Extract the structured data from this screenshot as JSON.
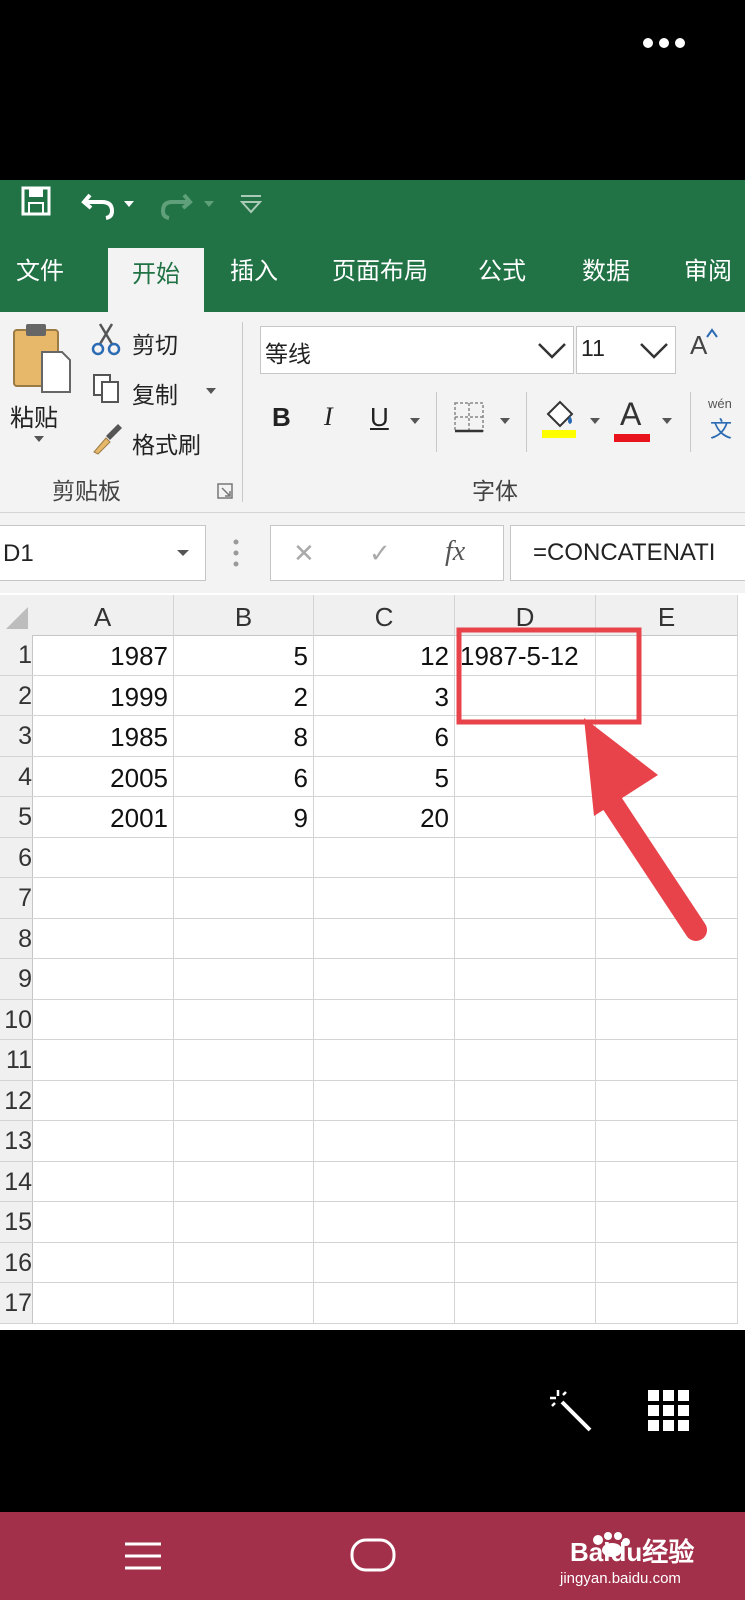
{
  "excel": {
    "tabs": [
      "文件",
      "开始",
      "插入",
      "页面布局",
      "公式",
      "数据",
      "审阅"
    ],
    "active_tab": "开始",
    "ribbon": {
      "paste": "粘贴",
      "cut": "剪切",
      "copy": "复制",
      "format_painter": "格式刷",
      "clipboard_group": "剪贴板",
      "font_name": "等线",
      "font_size": "11",
      "font_group": "字体",
      "bold": "B",
      "italic": "I",
      "underline": "U",
      "font_color_letter": "A",
      "grow_font_letter": "A",
      "phonetic_top": "wén",
      "phonetic_bottom": "文"
    },
    "formula_bar": {
      "name_box": "D1",
      "cancel": "✕",
      "enter": "✓",
      "fx": "fx",
      "formula": "=CONCATENATI"
    },
    "columns": [
      "A",
      "B",
      "C",
      "D",
      "E"
    ],
    "row_numbers": [
      "1",
      "2",
      "3",
      "4",
      "5",
      "6",
      "7",
      "8",
      "9",
      "10",
      "11",
      "12",
      "13",
      "14",
      "15",
      "16",
      "17"
    ],
    "rows": [
      [
        "1987",
        "5",
        "12",
        "1987-5-12",
        ""
      ],
      [
        "1999",
        "2",
        "3",
        "",
        ""
      ],
      [
        "1985",
        "8",
        "6",
        "",
        ""
      ],
      [
        "2005",
        "6",
        "5",
        "",
        ""
      ],
      [
        "2001",
        "9",
        "20",
        "",
        ""
      ]
    ],
    "colors": {
      "ribbon_green": "#217346",
      "highlight_red": "#e8434a"
    }
  },
  "watermark": {
    "site": "jingyan.baidu.com",
    "brand": "Baidu经验"
  }
}
